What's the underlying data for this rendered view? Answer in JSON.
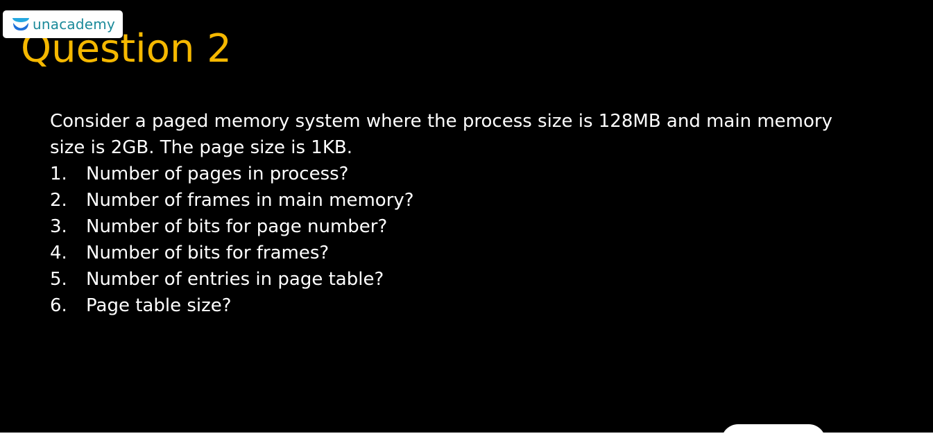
{
  "brand": {
    "name": "unacademy",
    "colors": {
      "logo_text": "#1b8a9a",
      "logo_icon_top": "#25a8e0",
      "logo_icon_bottom": "#1e6fd9"
    },
    "icon": "unacademy-logo-icon"
  },
  "slide": {
    "title": "Question 2",
    "title_color": "#f5b800",
    "background": "#000000",
    "intro": "Consider a paged memory system where the process size is 128MB and main memory size is 2GB. The page size is 1KB.",
    "questions": [
      {
        "num": "1.",
        "text": "Number of pages in process?"
      },
      {
        "num": "2.",
        "text": "Number of frames in main memory?"
      },
      {
        "num": "3.",
        "text": "Number of bits for page number?"
      },
      {
        "num": "4.",
        "text": "Number of bits for frames?"
      },
      {
        "num": "5.",
        "text": "Number of entries in page table?"
      },
      {
        "num": "6.",
        "text": "Page table size?"
      }
    ]
  }
}
